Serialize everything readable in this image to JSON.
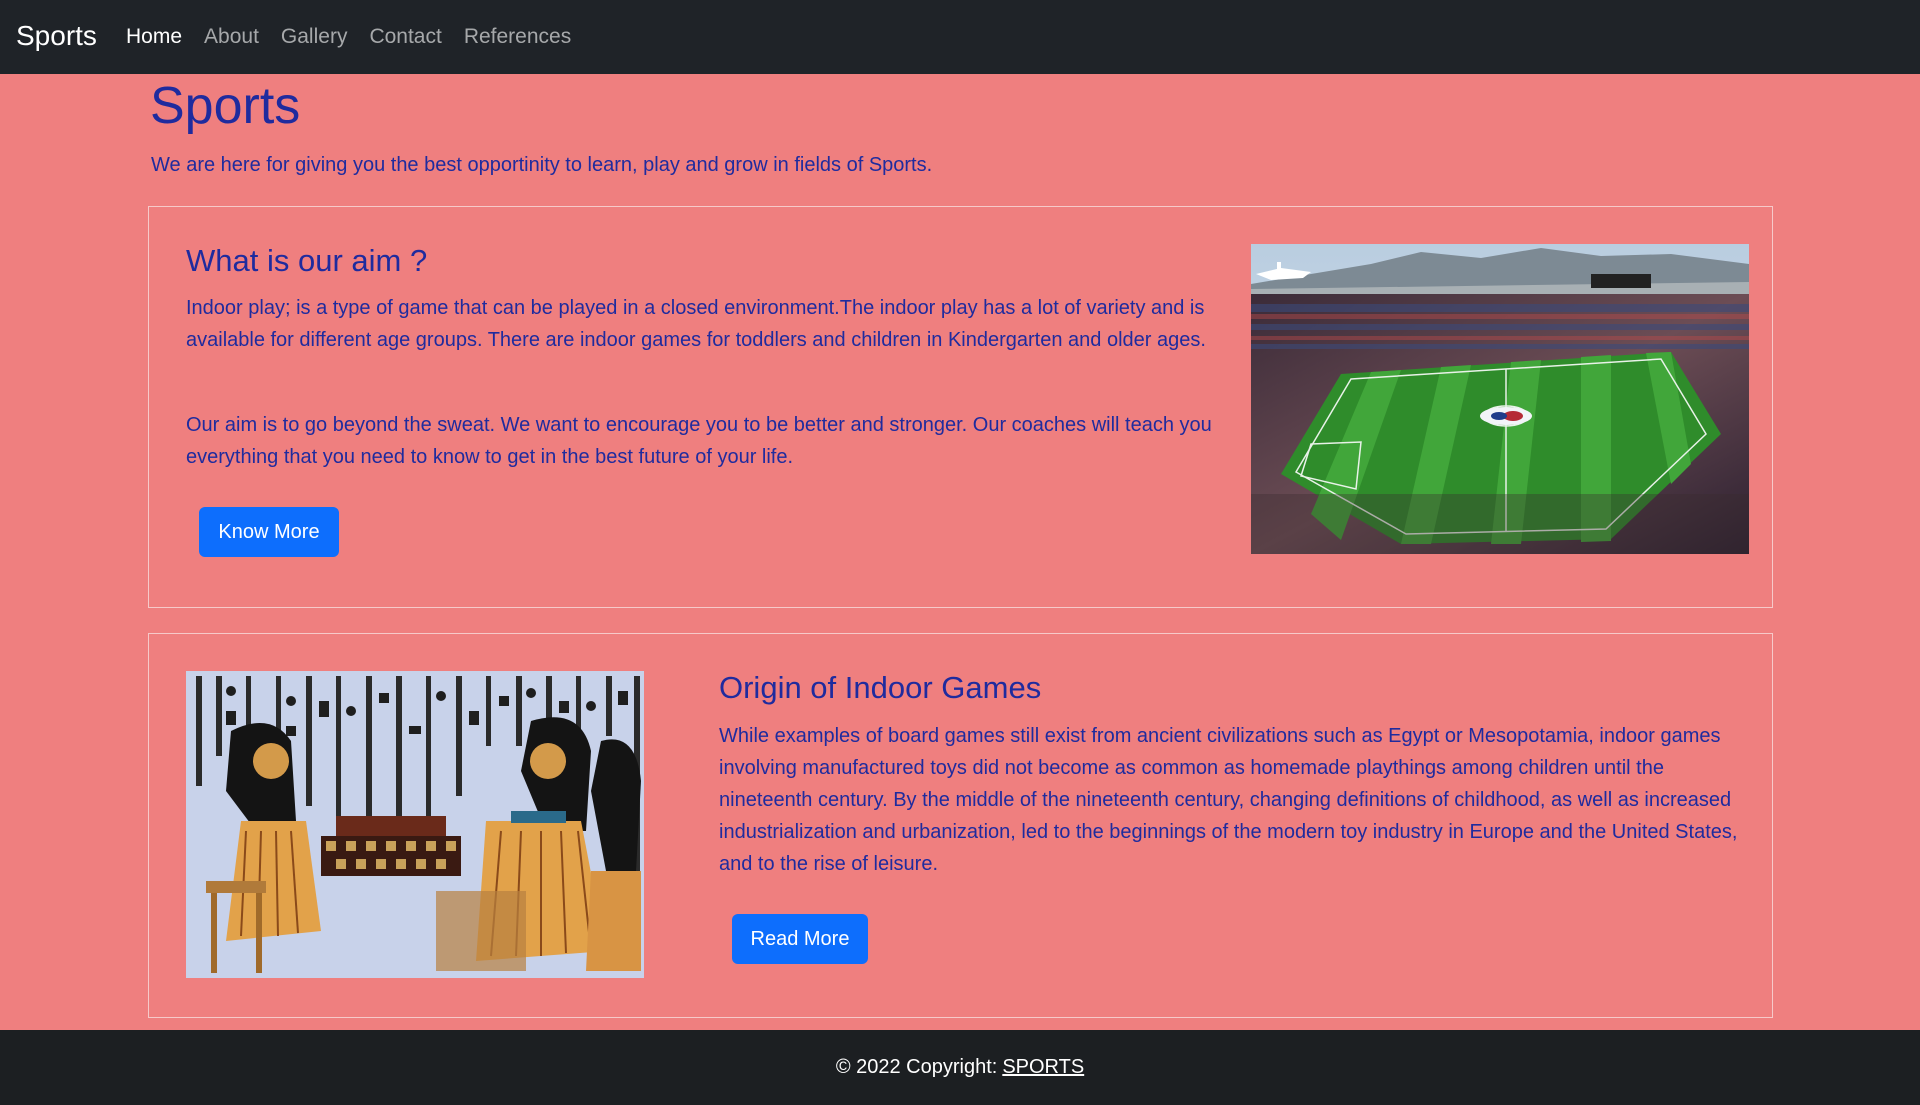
{
  "nav": {
    "brand": "Sports",
    "links": [
      {
        "label": "Home",
        "active": true
      },
      {
        "label": "About",
        "active": false
      },
      {
        "label": "Gallery",
        "active": false
      },
      {
        "label": "Contact",
        "active": false
      },
      {
        "label": "References",
        "active": false
      }
    ]
  },
  "hero": {
    "title": "Sports",
    "subtitle": "We are here for giving you the best opportinity to learn, play and grow in fields of Sports."
  },
  "sections": [
    {
      "title": "What is our aim ?",
      "paragraphs": [
        "Indoor play; is a type of game that can be played in a closed environment.The indoor play has a lot of variety and is available for different age groups. There are indoor games for toddlers and children in Kindergarten and older ages.",
        "Our aim is to go beyond the sweat. We want to encourage you to be better and stronger. Our coaches will teach you everything that you need to know to get in the best future of your life."
      ],
      "button": "Know More",
      "image": "stadium-photo"
    },
    {
      "title": "Origin of Indoor Games",
      "paragraphs": [
        "While examples of board games still exist from ancient civilizations such as Egypt or Mesopotamia, indoor games involving manufactured toys did not become as common as homemade playthings among children until the nineteenth century. By the middle of the nineteenth century, changing definitions of childhood, as well as increased industrialization and urbanization, led to the beginnings of the modern toy industry in Europe and the United States, and to the rise of leisure."
      ],
      "button": "Read More",
      "image": "egyptian-painting"
    }
  ],
  "footer": {
    "text": "© 2022 Copyright:",
    "link": "SPORTS"
  },
  "colors": {
    "page_bg": "#ef7f7f",
    "navbar_bg": "#1f2328",
    "footer_bg": "#1c1f22",
    "heading": "#1f2b9e",
    "button": "#0d6efd"
  }
}
